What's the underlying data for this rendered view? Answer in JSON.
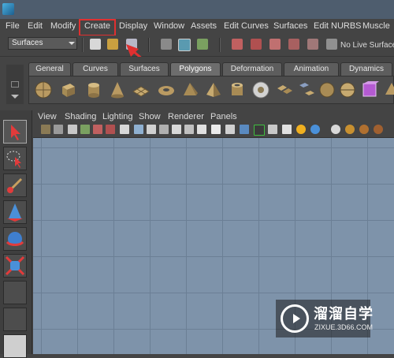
{
  "menubar": {
    "items": [
      "File",
      "Edit",
      "Modify",
      "Create",
      "Display",
      "Window",
      "Assets",
      "Edit Curves",
      "Surfaces",
      "Edit NURBS",
      "Muscle"
    ],
    "highlighted": "Create"
  },
  "statusline": {
    "mode": "Surfaces",
    "live_label": "No Live Surface"
  },
  "shelf": {
    "tabs": [
      "General",
      "Curves",
      "Surfaces",
      "Polygons",
      "Deformation",
      "Animation",
      "Dynamics"
    ],
    "active_tab": "Polygons"
  },
  "panel": {
    "menu": [
      "View",
      "Shading",
      "Lighting",
      "Show",
      "Renderer",
      "Panels"
    ]
  },
  "watermark": {
    "title": "溜溜自学",
    "url": "ZIXUE.3D66.COM"
  },
  "colors": {
    "highlight": "#e03030",
    "viewport": "#7e93aa",
    "ui_bg": "#444444"
  }
}
